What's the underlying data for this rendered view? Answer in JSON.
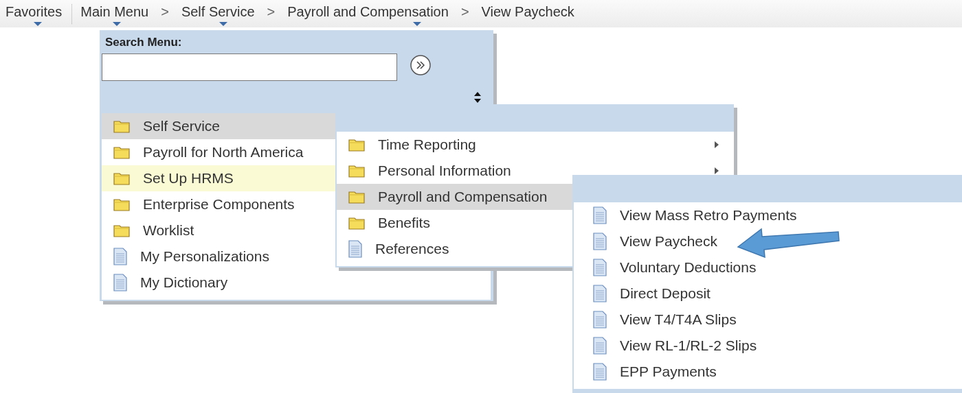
{
  "breadcrumb": [
    {
      "kind": "crumb",
      "label": "Favorites",
      "dropdown": true
    },
    {
      "kind": "crumb",
      "label": "Main Menu",
      "dropdown": true
    },
    {
      "kind": "separator",
      "label": ">"
    },
    {
      "kind": "crumb",
      "label": "Self Service",
      "dropdown": true
    },
    {
      "kind": "separator",
      "label": ">"
    },
    {
      "kind": "crumb",
      "label": "Payroll and Compensation",
      "dropdown": true
    },
    {
      "kind": "separator",
      "label": ">"
    },
    {
      "kind": "crumb",
      "label": "View Paycheck",
      "dropdown": false
    }
  ],
  "main_menu": {
    "search_label": "Search Menu:",
    "items": [
      {
        "kind": "folder",
        "label": "Self Service",
        "selected": true,
        "highlighted": false
      },
      {
        "kind": "folder",
        "label": "Payroll for North America",
        "selected": false,
        "highlighted": false
      },
      {
        "kind": "folder",
        "label": "Set Up HRMS",
        "selected": false,
        "highlighted": true
      },
      {
        "kind": "folder",
        "label": "Enterprise Components",
        "selected": false,
        "highlighted": false
      },
      {
        "kind": "folder",
        "label": "Worklist",
        "selected": false,
        "highlighted": false
      },
      {
        "kind": "page",
        "label": "My Personalizations",
        "selected": false,
        "highlighted": false
      },
      {
        "kind": "page",
        "label": "My Dictionary",
        "selected": false,
        "highlighted": false
      }
    ]
  },
  "submenu": {
    "items": [
      {
        "kind": "folder",
        "label": "Time Reporting",
        "selected": false,
        "has_submenu": true
      },
      {
        "kind": "folder",
        "label": "Personal Information",
        "selected": false,
        "has_submenu": true
      },
      {
        "kind": "folder",
        "label": "Payroll and Compensation",
        "selected": true,
        "has_submenu": false
      },
      {
        "kind": "folder",
        "label": "Benefits",
        "selected": false,
        "has_submenu": false
      },
      {
        "kind": "page",
        "label": "References",
        "selected": false,
        "has_submenu": false
      }
    ]
  },
  "payroll_menu": {
    "items": [
      {
        "kind": "page",
        "label": "View Mass Retro Payments",
        "selected": false
      },
      {
        "kind": "page",
        "label": "View Paycheck",
        "selected": false
      },
      {
        "kind": "page",
        "label": "Voluntary Deductions",
        "selected": false
      },
      {
        "kind": "page",
        "label": "Direct Deposit",
        "selected": false
      },
      {
        "kind": "page",
        "label": "View T4/T4A Slips",
        "selected": false
      },
      {
        "kind": "page",
        "label": "View RL-1/RL-2 Slips",
        "selected": false
      },
      {
        "kind": "page",
        "label": "EPP Payments",
        "selected": false
      }
    ]
  }
}
